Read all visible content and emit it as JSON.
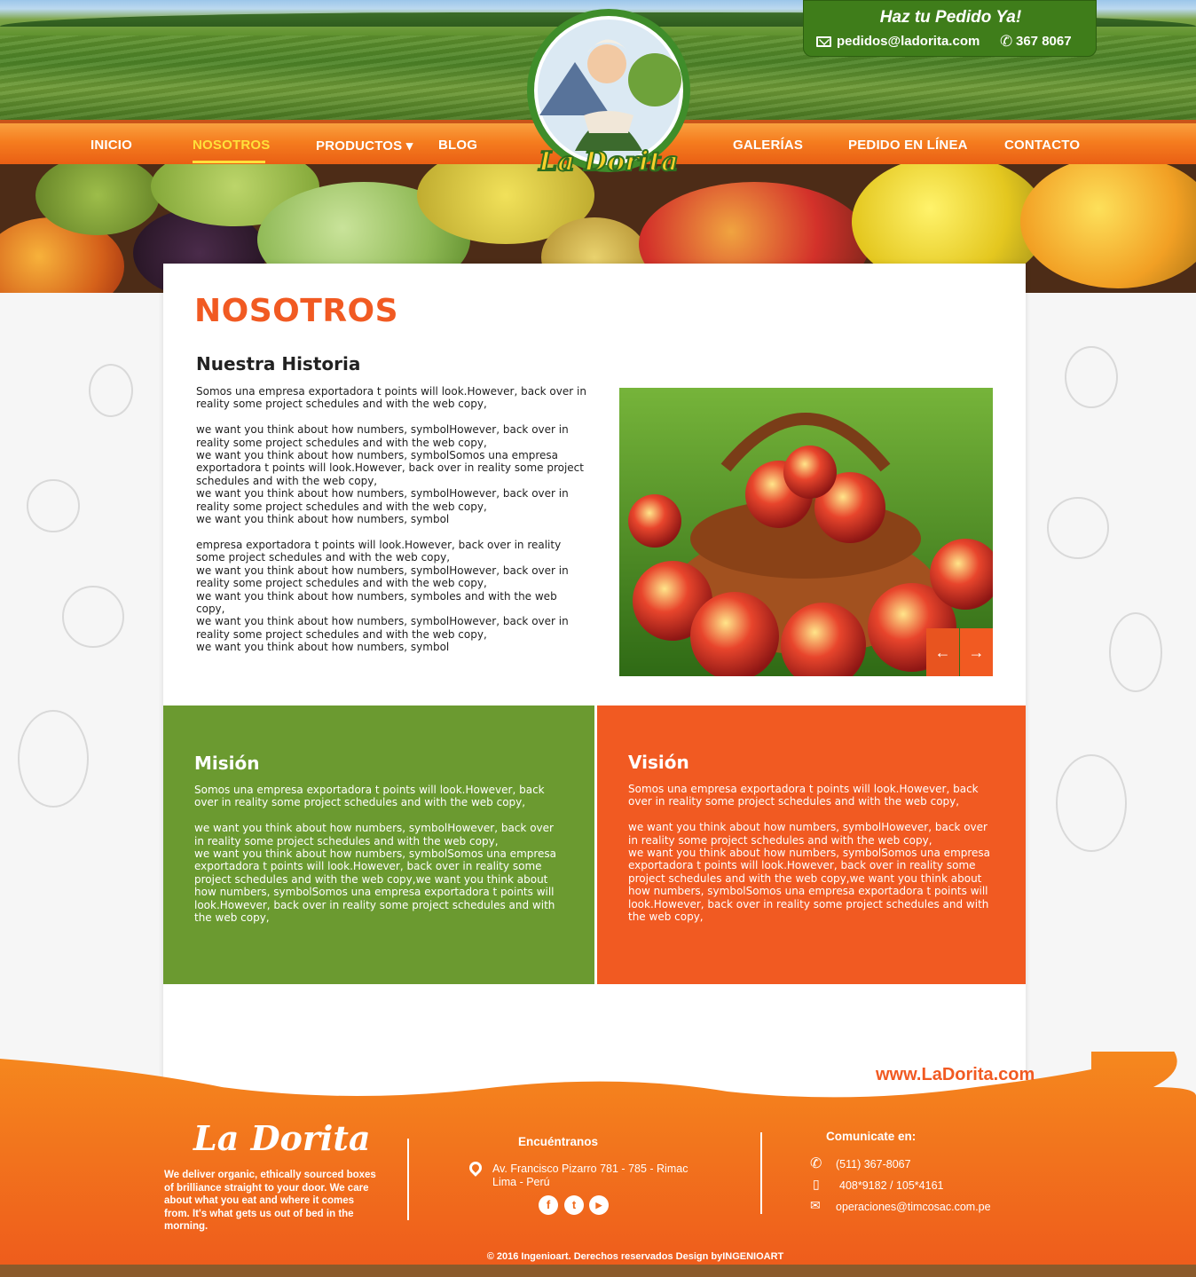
{
  "header": {
    "order_title": "Haz tu Pedido Ya!",
    "order_email": "pedidos@ladorita.com",
    "order_phone": "367 8067",
    "logo_text": "La Dorita"
  },
  "nav": {
    "items": [
      {
        "label": "INICIO"
      },
      {
        "label": "NOSOTROS",
        "active": true
      },
      {
        "label": "PRODUCTOS ▾"
      },
      {
        "label": "BLOG"
      },
      {
        "label": "GALERÍAS"
      },
      {
        "label": "PEDIDO EN LÍNEA"
      },
      {
        "label": "CONTACTO"
      }
    ]
  },
  "page": {
    "title": "NOSOTROS",
    "history_title": "Nuestra Historia",
    "history_text": "Somos una empresa exportadora t points will look.However, back over in reality some project schedules and with the web copy,\n\nwe want you think about how numbers, symbolHowever, back over in reality some project schedules and with the web copy,\nwe want you think about how numbers, symbolSomos una empresa exportadora t points will look.However, back over in reality some project schedules and with the web copy,\nwe want you think about how numbers, symbolHowever, back over in reality some project schedules and with the web copy,\nwe want you think about how numbers, symbol\n\nempresa exportadora t points will look.However, back over in reality some project schedules and with the web copy,\nwe want you think about how numbers, symbolHowever, back over in reality some project schedules and with the web copy,\nwe want you think about how numbers, symboles and with the web copy,\nwe want you think about how numbers, symbolHowever, back over in reality some project schedules and with the web copy,\nwe want you think about how numbers, symbol",
    "slider_prev": "←",
    "slider_next": "→"
  },
  "mission": {
    "title": "Misión",
    "text": "Somos una empresa exportadora t points will look.However, back over in reality some project schedules and with the web copy,\n\nwe want you think about how numbers, symbolHowever, back over in reality some project schedules and with the web copy,\nwe want you think about how numbers, symbolSomos una empresa exportadora t points will look.However, back over in reality some project schedules and with the web copy,we want you think about how numbers, symbolSomos una empresa exportadora t points will look.However, back over in reality some project schedules and with the web copy,"
  },
  "vision": {
    "title": "Visión",
    "text": "Somos una empresa exportadora t points will look.However, back over in reality some project schedules and with the web copy,\n\nwe want you think about how numbers, symbolHowever, back over in reality some project schedules and with the web copy,\nwe want you think about how numbers, symbolSomos una empresa exportadora t points will look.However, back over in reality some project schedules and with the web copy,we want you think about how numbers, symbolSomos una empresa exportadora t points will look.However, back over in reality some project schedules and with the web copy,"
  },
  "footer": {
    "site_url": "www.LaDorita.com",
    "brand": "La Dorita",
    "brand_text": "We deliver organic, ethically sourced boxes of brilliance straight to your door. We care about what you eat and where it comes from. It's what gets us out of bed in the morning.",
    "find_us_title": "Encuéntranos",
    "address": "Av. Francisco Pizarro 781 - 785 - Rimac Lima - Perú",
    "social": [
      {
        "icon": "facebook-icon",
        "glyph": "f"
      },
      {
        "icon": "twitter-icon",
        "glyph": "t"
      },
      {
        "icon": "youtube-icon",
        "glyph": "▶"
      }
    ],
    "contact_title": "Comunicate  en:",
    "phone": "(511) 367-8067",
    "mobile": "408*9182 / 105*4161",
    "email": "operaciones@timcosac.com.pe",
    "copyright": "© 2016 Ingenioart. Derechos reservados Design byINGENIOART"
  },
  "colors": {
    "accent_orange": "#f15a22",
    "green": "#6b9a30",
    "nav_active": "#ffe03a"
  }
}
